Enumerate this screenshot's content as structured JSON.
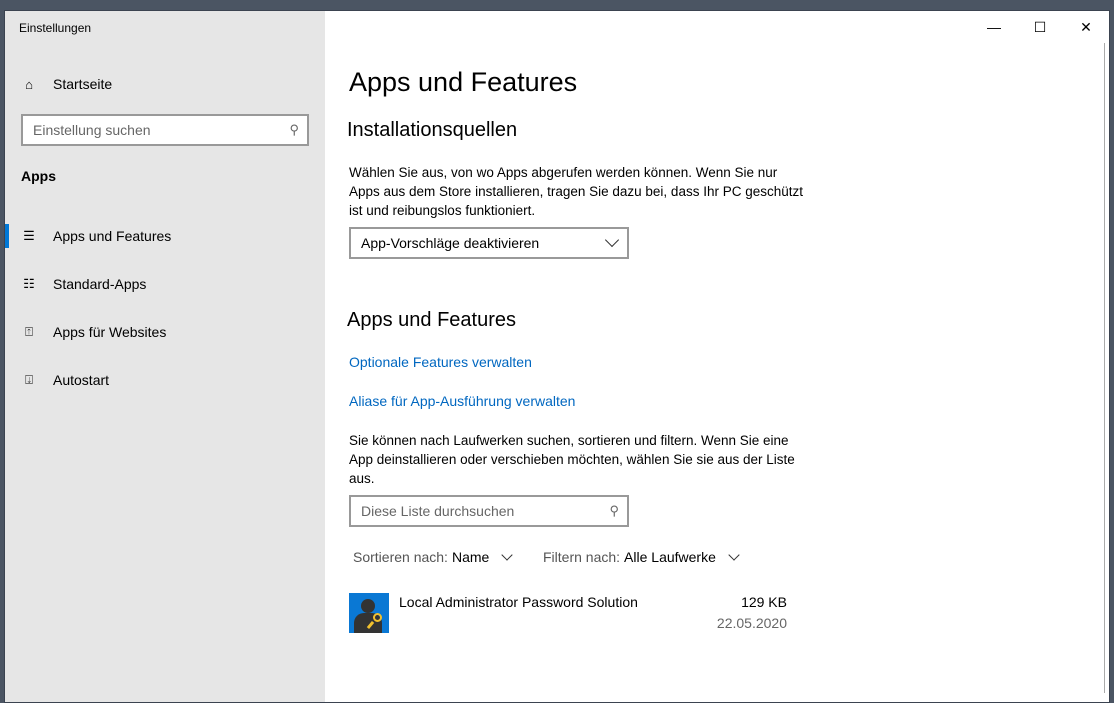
{
  "window": {
    "title": "Einstellungen",
    "minimize": "—",
    "maximize": "☐",
    "close": "✕"
  },
  "sidebar": {
    "home": "Startseite",
    "search_placeholder": "Einstellung suchen",
    "section": "Apps",
    "items": [
      {
        "label": "Apps und Features",
        "icon": "list-icon",
        "selected": true
      },
      {
        "label": "Standard-Apps",
        "icon": "default-apps-icon"
      },
      {
        "label": "Apps für Websites",
        "icon": "websites-icon"
      },
      {
        "label": "Autostart",
        "icon": "startup-icon"
      }
    ]
  },
  "main": {
    "title": "Apps und Features",
    "install": {
      "heading": "Installationsquellen",
      "text": "Wählen Sie aus, von wo Apps abgerufen werden können. Wenn Sie nur Apps aus dem Store installieren, tragen Sie dazu bei, dass Ihr PC geschützt ist und reibungslos funktioniert.",
      "dropdown": "App-Vorschläge deaktivieren"
    },
    "apps": {
      "heading": "Apps und Features",
      "link1": "Optionale Features verwalten",
      "link2": "Aliase für App-Ausführung verwalten",
      "text": "Sie können nach Laufwerken suchen, sortieren und filtern. Wenn Sie eine App deinstallieren oder verschieben möchten, wählen Sie sie aus der Liste aus.",
      "search_placeholder": "Diese Liste durchsuchen",
      "sort_label": "Sortieren nach:",
      "sort_value": "Name",
      "filter_label": "Filtern nach:",
      "filter_value": "Alle Laufwerke",
      "list": [
        {
          "name": "Local Administrator Password Solution",
          "size": "129 KB",
          "date": "22.05.2020"
        }
      ]
    }
  },
  "colors": {
    "accent": "#0078d7",
    "link": "#0067c0",
    "sidebar": "#e6e6e6"
  }
}
